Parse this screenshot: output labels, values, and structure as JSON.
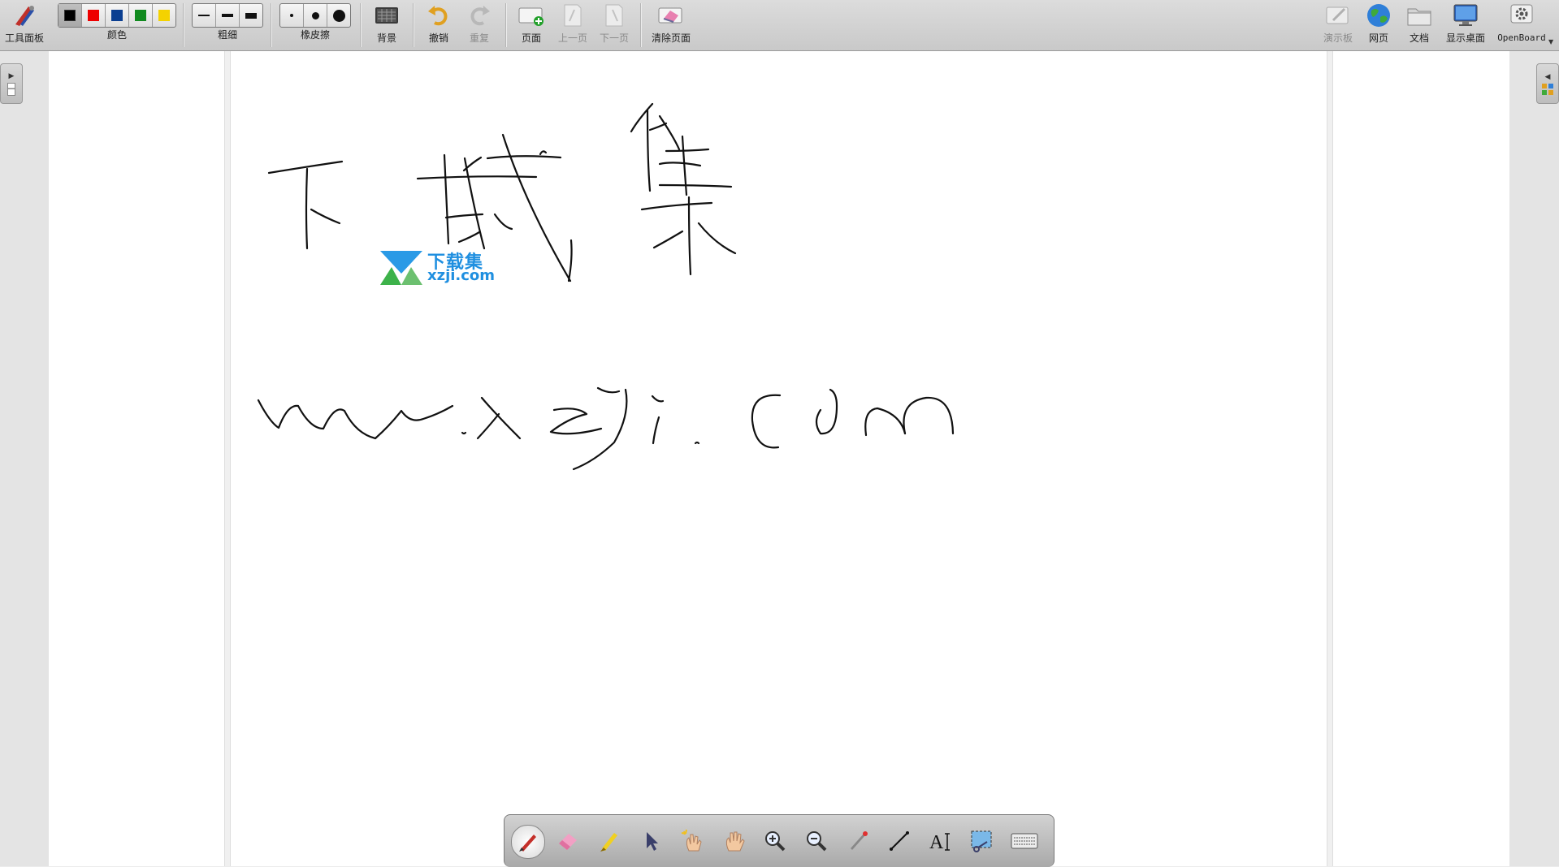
{
  "toolbar": {
    "tool_panel": "工具面板",
    "color": "颜色",
    "thickness": "粗细",
    "eraser": "橡皮擦",
    "background": "背景",
    "undo": "撤销",
    "redo": "重复",
    "page": "页面",
    "prev_page": "上一页",
    "next_page": "下一页",
    "clear_page": "清除页面",
    "board": "演示板",
    "web": "网页",
    "documents": "文档",
    "show_desktop": "显示桌面",
    "openboard": "OpenBoard"
  },
  "colors": {
    "swatches": [
      "#000000",
      "#ee0000",
      "#0b3f91",
      "#118a1f",
      "#f4d200"
    ],
    "accent": "#1f8fe0"
  },
  "watermark": {
    "title": "下载集",
    "subtitle": "xzji.com"
  },
  "palette_icons": [
    "pen-icon",
    "eraser-icon",
    "highlighter-icon",
    "pointer-icon",
    "laser-pointer-icon",
    "hand-icon",
    "zoom-in-icon",
    "zoom-out-icon",
    "capture-icon",
    "line-icon",
    "text-icon",
    "selection-icon",
    "keyboard-icon"
  ]
}
